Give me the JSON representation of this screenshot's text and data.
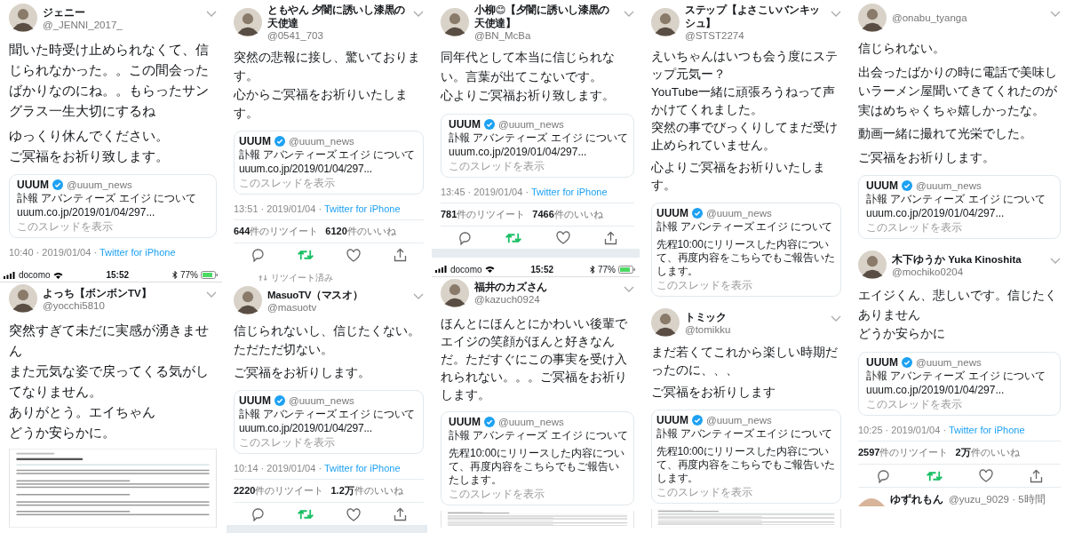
{
  "columns": [
    {
      "panels": [
        {
          "author": {
            "name": "ジェニー",
            "handle": "@_JENNI_2017_"
          },
          "paragraphs": [
            [
              "聞いた時受け止められなくて、信じられなかった。。この間会ったばかりなのにね。。もらったサングラス一生大切にするね"
            ],
            [
              "ゆっくり休んでください。",
              "ご冥福をお祈り致します。"
            ]
          ],
          "quote": {
            "name": "UUUM",
            "handle": "@uuum_news",
            "title": "訃報 アバンティーズ エイジ について",
            "url": "uuum.co.jp/2019/01/04/297...",
            "thread": "このスレッドを表示"
          },
          "meta": {
            "time": "10:40 · 2019/01/04 · ",
            "source": "Twitter for iPhone"
          }
        },
        {
          "status_bar": {
            "carrier": "docomo",
            "time": "15:52",
            "battery": "77%"
          },
          "author": {
            "name": "よっち【ボンボンTV】",
            "handle": "@yocchi5810"
          },
          "paragraphs": [
            [
              "突然すぎて未だに実感が湧きません",
              "また元気な姿で戻ってくる気がしてなりません。",
              "ありがとう。エイちゃん",
              "どうか安らかに。"
            ]
          ],
          "document": true
        }
      ]
    },
    {
      "panels": [
        {
          "author": {
            "name": "ともやん 夕闇に誘いし漆黒の天使達",
            "handle": "@0541_703"
          },
          "paragraphs": [
            [
              "突然の悲報に接し、驚いております。",
              "心からご冥福をお祈りいたします。"
            ]
          ],
          "quote": {
            "name": "UUUM",
            "handle": "@uuum_news",
            "title": "訃報 アバンティーズ エイジ について",
            "url": "uuum.co.jp/2019/01/04/297...",
            "thread": "このスレッドを表示"
          },
          "meta": {
            "time": "13:51 · 2019/01/04 · ",
            "source": "Twitter for iPhone"
          },
          "stats": [
            "**644**件のリツイート",
            "**6120**件のいいね"
          ],
          "actions": {
            "retweeted": true
          }
        },
        {
          "retweeted_label": "リツイート済み",
          "author": {
            "name": "MasuoTV（マスオ）",
            "handle": "@masuotv"
          },
          "paragraphs": [
            [
              "信じられないし、信じたくない。",
              "ただただ切ない。"
            ],
            [
              "ご冥福をお祈りします。"
            ]
          ],
          "quote": {
            "name": "UUUM",
            "handle": "@uuum_news",
            "title": "訃報 アバンティーズ エイジ について",
            "url": "uuum.co.jp/2019/01/04/297...",
            "thread": "このスレッドを表示"
          },
          "meta": {
            "time": "10:14 · 2019/01/04 · ",
            "source": "Twitter for iPhone"
          },
          "stats": [
            "**2220**件のリツイート",
            "**1.2万**件のいいね"
          ],
          "actions": {
            "retweeted": true
          },
          "separator": true
        }
      ]
    },
    {
      "panels": [
        {
          "author": {
            "name": "小柳😊【夕闇に誘いし漆黒の天使達】",
            "handle": "@BN_McBa"
          },
          "paragraphs": [
            [
              "同年代として本当に信じられない。言葉が出てこないです。",
              "心よりご冥福お祈り致します。"
            ]
          ],
          "quote": {
            "name": "UUUM",
            "handle": "@uuum_news",
            "title": "訃報 アバンティーズ エイジ について",
            "url": "uuum.co.jp/2019/01/04/297...",
            "thread": "このスレッドを表示"
          },
          "meta": {
            "time": "13:45 · 2019/01/04 · ",
            "source": "Twitter for iPhone"
          },
          "stats": [
            "**781**件のリツイート",
            "**7466**件のいいね"
          ],
          "actions": {
            "retweeted": true
          },
          "separator": true
        },
        {
          "status_bar": {
            "carrier": "docomo",
            "time": "15:52",
            "battery": "77%"
          },
          "author": {
            "name": "福井のカズさん",
            "handle": "@kazuch0924"
          },
          "paragraphs": [
            [
              "ほんとにほんとにかわいい後輩でエイジの笑顔がほんと好きなんだ。ただすぐにこの事実を受け入れられない。。。ご冥福をお祈りします。"
            ]
          ],
          "quote": {
            "name": "UUUM",
            "handle": "@uuum_news",
            "title": "訃報 アバンティーズ エイジ について",
            "body": "先程10:00にリリースした内容について、再度内容をこちらでもご報告いたします。",
            "thread": "このスレッドを表示"
          },
          "document": true
        }
      ]
    },
    {
      "panels": [
        {
          "author": {
            "name": "ステップ【よさこいバンキッシュ】",
            "handle": "@STST2274"
          },
          "paragraphs": [
            [
              "えいちゃんはいつも会う度にステップ元気ー？",
              "YouTube一緒に頑張ろうねって声かけてくれました。",
              "突然の事でびっくりしてまだ受け止められていません。"
            ],
            [
              "心よりご冥福をお祈りいたします。"
            ]
          ],
          "quote": {
            "name": "UUUM",
            "handle": "@uuum_news",
            "title": "訃報 アバンティーズ エイジ について",
            "body": "先程10:00にリリースした内容について、再度内容をこちらでもご報告いたします。",
            "thread": "このスレッドを表示"
          }
        },
        {
          "author": {
            "name": "トミック",
            "handle": "@tomikku"
          },
          "paragraphs": [
            [
              "まだ若くてこれから楽しい時期だったのに、、、"
            ],
            [
              "ご冥福をお祈りします"
            ]
          ],
          "quote": {
            "name": "UUUM",
            "handle": "@uuum_news",
            "title": "訃報 アバンティーズ エイジ について",
            "body": "先程10:00にリリースした内容について、再度内容をこちらでもご報告いたします。",
            "thread": "このスレッドを表示"
          },
          "document": true
        }
      ]
    },
    {
      "panels": [
        {
          "author": {
            "handle": "@onabu_tyanga"
          },
          "paragraphs": [
            [
              "信じられない。"
            ],
            [
              "出会ったばかりの時に電話で美味しいラーメン屋聞いてきてくれたのが実はめちゃくちゃ嬉しかったな。"
            ],
            [
              "動画一緒に撮れて光栄でした。"
            ],
            [
              "ご冥福をお祈りします。"
            ]
          ],
          "quote": {
            "name": "UUUM",
            "handle": "@uuum_news",
            "title": "訃報 アバンティーズ エイジ について",
            "url": "uuum.co.jp/2019/01/04/297...",
            "thread": "このスレッドを表示"
          }
        },
        {
          "author": {
            "name": "木下ゆうか Yuka Kinoshita",
            "handle": "@mochiko0204"
          },
          "paragraphs": [
            [
              "エイジくん、悲しいです。信じたくありません",
              "どうか安らかに"
            ]
          ],
          "quote": {
            "name": "UUUM",
            "handle": "@uuum_news",
            "title": "訃報 アバンティーズ エイジ について",
            "url": "uuum.co.jp/2019/01/04/297...",
            "thread": "このスレッドを表示"
          },
          "meta": {
            "time": "10:25 · 2019/01/04 · ",
            "source": "Twitter for iPhone"
          },
          "stats": [
            "**2597**件のリツイート",
            "**2万**件のいいね"
          ],
          "actions": {
            "retweeted": true
          },
          "next_tweet": {
            "name": "ゆずれもん",
            "handle": "@yuzu_9029 · 5時間"
          }
        }
      ]
    }
  ]
}
